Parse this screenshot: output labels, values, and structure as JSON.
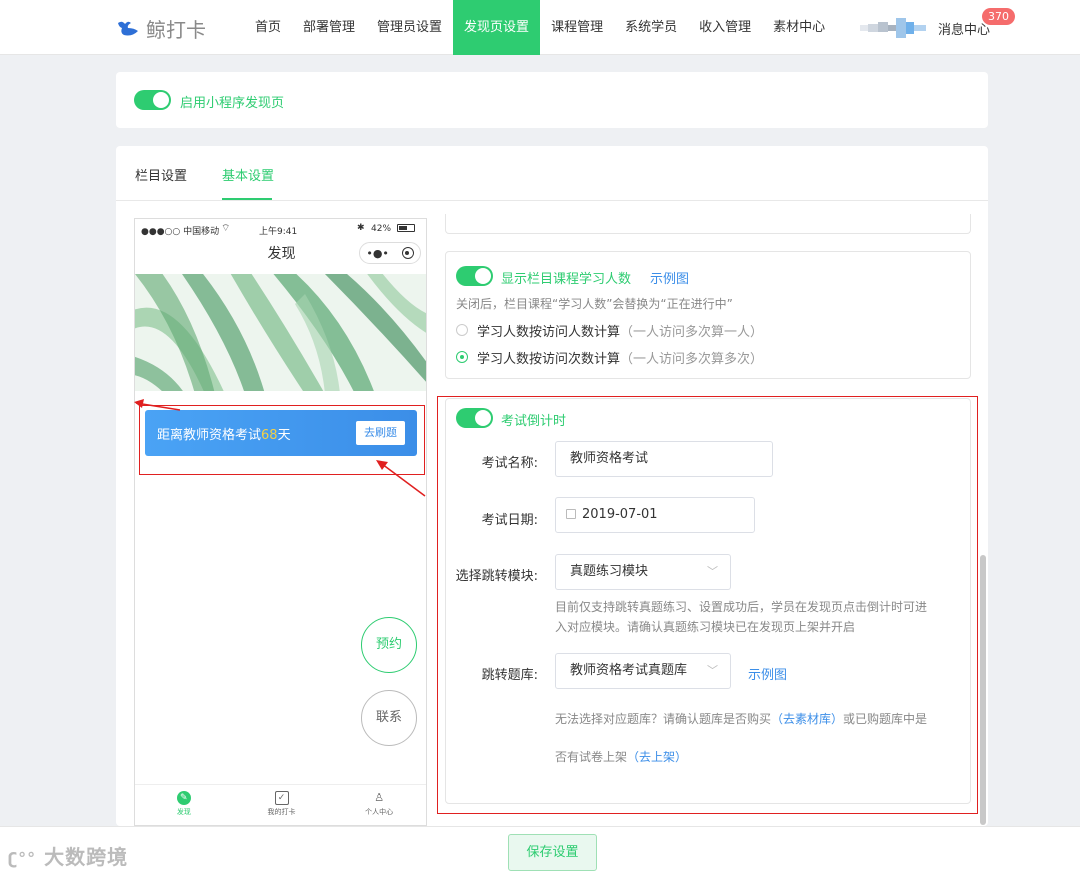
{
  "nav": {
    "logo_text": "鲸打卡",
    "items": [
      "首页",
      "部署管理",
      "管理员设置",
      "发现页设置",
      "课程管理",
      "系统学员",
      "收入管理",
      "素材中心"
    ],
    "active_index": 3,
    "message_center": "消息中心",
    "message_count": "370"
  },
  "enable_card": {
    "label": "启用小程序发现页",
    "enabled": true
  },
  "tabs": [
    "栏目设置",
    "基本设置"
  ],
  "active_tab": 1,
  "phone": {
    "status_left": "●●●○○ 中国移动",
    "status_time": "上午9:41",
    "status_battery": "42%",
    "title": "发现",
    "capsule_dots": "•●•",
    "countdown_prefix": "距离教师资格考试",
    "countdown_days": "68",
    "countdown_suffix": "天",
    "countdown_button": "去刷题",
    "reserve_button": "预约",
    "contact_button": "联系",
    "tabbar": [
      "发现",
      "我的打卡",
      "个人中心"
    ]
  },
  "learner_count": {
    "toggle_label": "显示栏目课程学习人数",
    "example_link": "示例图",
    "hint": "关闭后，栏目课程“学习人数”会替换为“正在进行中”",
    "option1": "学习人数按访问人数计算",
    "option1_note": "（一人访问多次算一人）",
    "option2": "学习人数按访问次数计算",
    "option2_note": "（一人访问多次算多次）",
    "selected": 2
  },
  "exam": {
    "toggle_label": "考试倒计时",
    "name_label": "考试名称:",
    "name_value": "教师资格考试",
    "date_label": "考试日期:",
    "date_value": "2019-07-01",
    "module_label": "选择跳转模块:",
    "module_value": "真题练习模块",
    "module_hint_line1": "目前仅支持跳转真题练习、设置成功后，学员在发现页点击倒计时可进",
    "module_hint_line2": "入对应模块。请确认真题练习模块已在发现页上架并开启",
    "bank_label": "跳转题库:",
    "bank_value": "教师资格考试真题库",
    "bank_example": "示例图",
    "bank_hint_prefix": "无法选择对应题库？请确认题库是否购买",
    "bank_link1": "（去素材库）",
    "bank_hint_mid": "或已购题库中是",
    "bank_hint_line2": "否有试卷上架",
    "bank_link2": "（去上架）"
  },
  "footer": {
    "save": "保存设置",
    "watermark": "大数跨境"
  },
  "colors": {
    "accent": "#2ecc71",
    "link": "#3b8ee8",
    "annotation": "#e02020",
    "badge": "#f56c6c"
  }
}
